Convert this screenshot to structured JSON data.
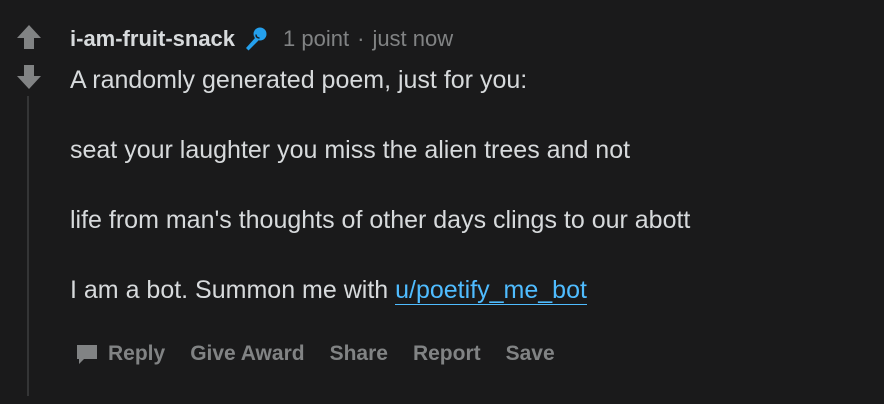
{
  "comment": {
    "author": "i-am-fruit-snack",
    "author_icon": "microphone-icon",
    "score": "1 point",
    "separator": "·",
    "timestamp": "just now",
    "body": {
      "line1": "A randomly generated poem, just for you:",
      "line2": "seat your laughter you miss the alien trees and not",
      "line3": "life from man's thoughts of other days clings to our abott",
      "bot_prefix": "I am a bot. Summon me with ",
      "bot_link": "u/poetify_me_bot"
    },
    "actions": {
      "reply": "Reply",
      "give_award": "Give Award",
      "share": "Share",
      "report": "Report",
      "save": "Save"
    }
  },
  "colors": {
    "background": "#1a1a1b",
    "text": "#d7dadc",
    "muted": "#818384",
    "link": "#4fbcff",
    "accent_icon": "#24a0ed"
  }
}
